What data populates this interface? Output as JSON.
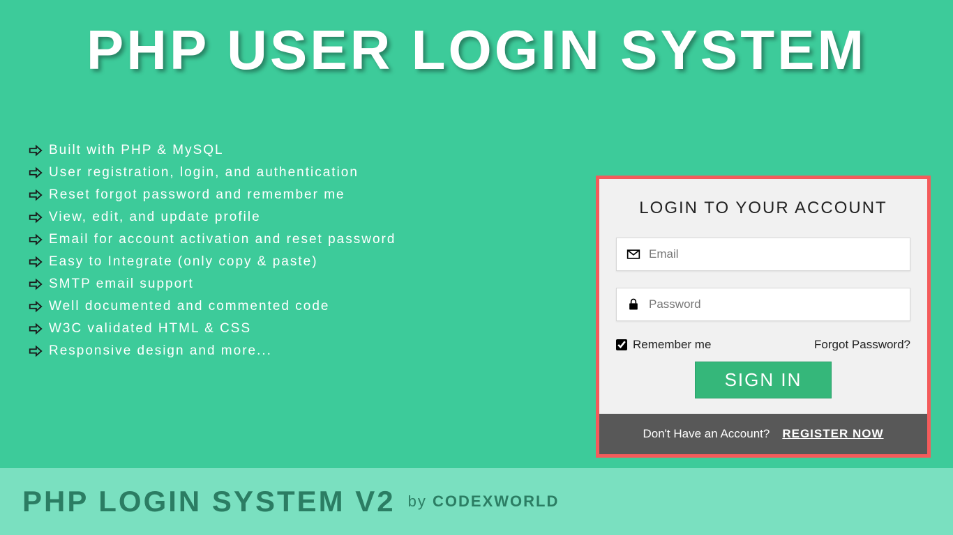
{
  "hero": {
    "title": "PHP USER LOGIN SYSTEM"
  },
  "features": {
    "items": [
      "Built with PHP & MySQL",
      "User registration, login, and authentication",
      "Reset forgot password and remember me",
      "View, edit, and update profile",
      "Email for account activation and reset password",
      "Easy to Integrate (only copy & paste)",
      "SMTP email support",
      "Well documented and commented code",
      "W3C validated HTML & CSS",
      "Responsive design and more..."
    ]
  },
  "footer": {
    "title": "PHP LOGIN SYSTEM V2",
    "by_prefix": "by",
    "by_brand": "CODEXWORLD"
  },
  "login": {
    "heading": "LOGIN TO YOUR ACCOUNT",
    "email_placeholder": "Email",
    "password_placeholder": "Password",
    "remember_label": "Remember me",
    "forgot_label": "Forgot Password?",
    "signin_label": "SIGN IN",
    "noaccount_text": "Don't Have an Account?",
    "register_label": "REGISTER NOW"
  }
}
